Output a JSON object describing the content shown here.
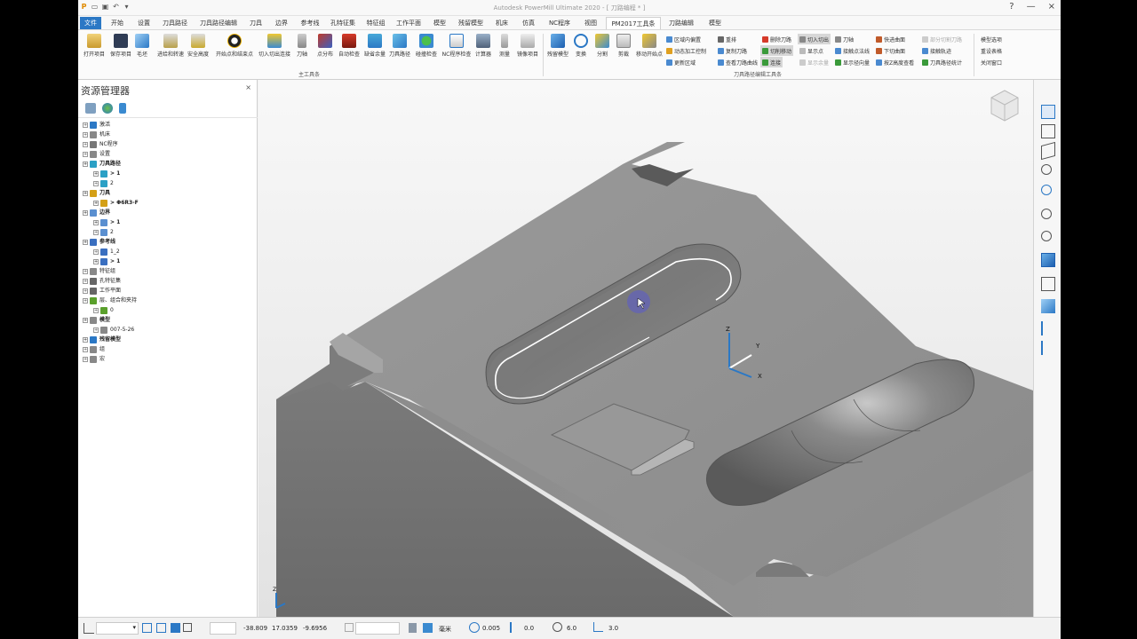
{
  "window": {
    "title": "Autodesk PowerMill Ultimate 2020 - [ 刀路编程 * ]",
    "controls": [
      "?",
      "—",
      "×"
    ]
  },
  "tabs": [
    "文件",
    "开始",
    "设置",
    "刀具路径",
    "刀具路径编辑",
    "刀具",
    "边界",
    "参考线",
    "孔特征集",
    "特征组",
    "工作平面",
    "模型",
    "残留模型",
    "机床",
    "仿真",
    "NC程序",
    "视图",
    "PM2017工具条",
    "刀路编辑",
    "模型"
  ],
  "active_tab": "PM2017工具条",
  "ribbon": {
    "main_buttons": [
      "打开项目",
      "保存项目",
      "毛坯",
      "进给和转速",
      "安全高度",
      "开始点和结束点",
      "切入切出连接",
      "刀轴",
      "点分布",
      "自动检查",
      "缺省余量",
      "刀具路径",
      "碰撞检查",
      "NC程序检查",
      "计算器",
      "测量",
      "镜像项目"
    ],
    "main_group_label": "主工具条",
    "edit_buttons": [
      "残留模型",
      "变换",
      "分割",
      "剪裁",
      "移动开始点"
    ],
    "edit_small_col1": [
      "区域内偏置",
      "动态加工控制",
      "更新区域"
    ],
    "edit_small_col2": [
      "重排",
      "复制刀路",
      "查看刀路曲线"
    ],
    "edit_small_col3": [
      "删除刀路",
      "切削移动",
      "连接"
    ],
    "edit_small_col4": [
      "切入切出",
      "显示点",
      "显示余量"
    ],
    "edit_small_col5": [
      "刀轴",
      "接触点法线",
      "显示径向量"
    ],
    "edit_small_col6": [
      "快进曲面",
      "下切曲面",
      "按Z高度查看"
    ],
    "edit_small_col7": [
      "部分切割刀路",
      "接触轨迹",
      "刀具路径统计"
    ],
    "edit_group_label": "刀具路径编辑工具条",
    "right_links": [
      "模型选项",
      "重设表格",
      "关闭窗口"
    ]
  },
  "explorer": {
    "title": "资源管理器",
    "close": "×",
    "tree": [
      {
        "label": "激活",
        "level": 0,
        "icon": "#2b78c5"
      },
      {
        "label": "机床",
        "level": 0,
        "icon": "#888"
      },
      {
        "label": "NC程序",
        "level": 0,
        "icon": "#777"
      },
      {
        "label": "设置",
        "level": 0,
        "icon": "#888"
      },
      {
        "label": "刀具路径",
        "level": 0,
        "icon": "#2ba0c5",
        "bold": true
      },
      {
        "label": "> 1",
        "level": 1,
        "icon": "#2ba0c5",
        "bold": true
      },
      {
        "label": "2",
        "level": 1,
        "icon": "#2ba0c5"
      },
      {
        "label": "刀具",
        "level": 0,
        "icon": "#d4a017",
        "bold": true
      },
      {
        "label": "> Φ6R3-F",
        "level": 1,
        "icon": "#d4a017",
        "bold": true
      },
      {
        "label": "边界",
        "level": 0,
        "icon": "#5a8fd0",
        "bold": true
      },
      {
        "label": "> 1",
        "level": 1,
        "icon": "#5a8fd0",
        "bold": true
      },
      {
        "label": "2",
        "level": 1,
        "icon": "#5a8fd0"
      },
      {
        "label": "参考线",
        "level": 0,
        "icon": "#3a6fc0",
        "bold": true
      },
      {
        "label": "1_2",
        "level": 1,
        "icon": "#3a6fc0"
      },
      {
        "label": "> 1",
        "level": 1,
        "icon": "#3a6fc0",
        "bold": true
      },
      {
        "label": "特征组",
        "level": 0,
        "icon": "#888"
      },
      {
        "label": "孔特征集",
        "level": 0,
        "icon": "#666"
      },
      {
        "label": "工作平面",
        "level": 0,
        "icon": "#666"
      },
      {
        "label": "层、组合和夹持",
        "level": 0,
        "icon": "#5aa02c"
      },
      {
        "label": "0",
        "level": 1,
        "icon": "#5aa02c"
      },
      {
        "label": "模型",
        "level": 0,
        "icon": "#888",
        "bold": true
      },
      {
        "label": "007-5-26",
        "level": 1,
        "icon": "#888"
      },
      {
        "label": "残留模型",
        "level": 0,
        "icon": "#2b78c5",
        "bold": true
      },
      {
        "label": "组",
        "level": 0,
        "icon": "#888"
      },
      {
        "label": "宏",
        "level": 0,
        "icon": "#888"
      }
    ]
  },
  "viewport": {
    "axis_labels": [
      "Z",
      "Y",
      "X"
    ]
  },
  "status": {
    "coords": [
      "-38.809",
      "17.0359",
      "-9.6956"
    ],
    "unit": "毫米",
    "tolerance": "0.005",
    "offset": "0.0",
    "diameter": "6.0",
    "angle": "3.0"
  },
  "colors": {
    "file_tab": "#2b78c5",
    "part": "#8e8e8e",
    "selection": "#ffffff"
  }
}
